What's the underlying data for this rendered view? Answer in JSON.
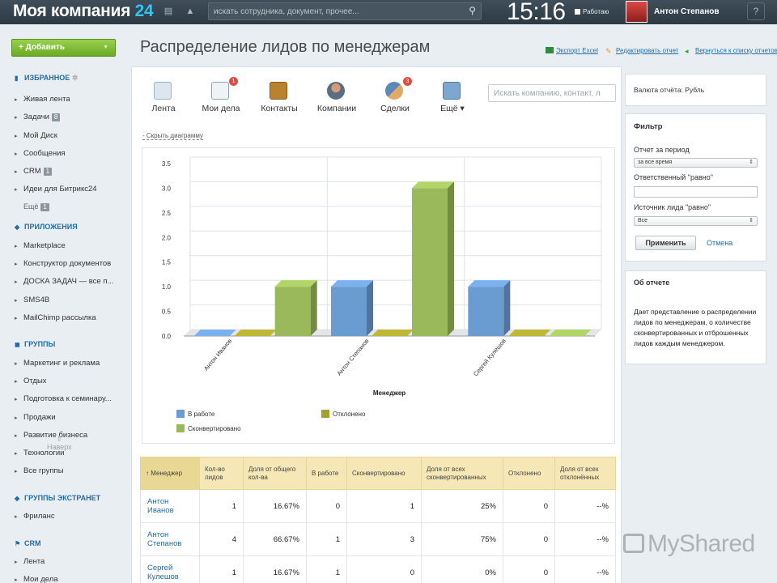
{
  "topbar": {
    "logo_main": "Моя компания",
    "logo_num": "24",
    "search_placeholder": "искать сотрудника, документ, прочее...",
    "clock": "15:16",
    "status": "Работаю",
    "user_name": "Антон Степанов",
    "help": "?"
  },
  "sidebar": {
    "add_label": "Добавить",
    "fav_header": "ИЗБРАННОЕ",
    "fav": [
      {
        "label": "Живая лента"
      },
      {
        "label": "Задачи",
        "count": "8"
      },
      {
        "label": "Мой Диск"
      },
      {
        "label": "Сообщения"
      },
      {
        "label": "CRM",
        "count": "1"
      },
      {
        "label": "Идеи для Битрикс24"
      }
    ],
    "fav_more": "Ещё",
    "fav_more_count": "1",
    "apps_header": "ПРИЛОЖЕНИЯ",
    "apps": [
      {
        "label": "Marketplace"
      },
      {
        "label": "Конструктор документов"
      },
      {
        "label": "ДОСКА ЗАДАЧ — все п..."
      },
      {
        "label": "SMS4B"
      },
      {
        "label": "MailChimp рассылка"
      }
    ],
    "groups_header": "ГРУППЫ",
    "groups": [
      {
        "label": "Маркетинг и реклама"
      },
      {
        "label": "Отдых"
      },
      {
        "label": "Подготовка к семинару..."
      },
      {
        "label": "Продажи"
      },
      {
        "label": "Развитие бизнеса"
      },
      {
        "label": "Технологии"
      },
      {
        "label": "Все группы"
      }
    ],
    "up_label": "Наверх",
    "extranet_header": "ГРУППЫ ЭКСТРАНЕТ",
    "extranet": [
      {
        "label": "Фриланс"
      }
    ],
    "crm_header": "CRM",
    "crm": [
      {
        "label": "Лента"
      },
      {
        "label": "Мои дела"
      }
    ]
  },
  "header": {
    "title": "Распределение лидов по менеджерам",
    "links": [
      "Экспорт Excel",
      "Редактировать отчет",
      "Вернуться к списку отчетов"
    ]
  },
  "nav": {
    "items": [
      {
        "label": "Лента"
      },
      {
        "label": "Мои дела",
        "badge": "1"
      },
      {
        "label": "Контакты"
      },
      {
        "label": "Компании"
      },
      {
        "label": "Сделки",
        "badge": "3"
      },
      {
        "label": "Ещё ▾"
      }
    ],
    "search_placeholder": "Искать компанию, контакт, л"
  },
  "hide_chart": "Скрыть диаграмму",
  "chart_data": {
    "type": "bar",
    "categories": [
      "Антон Иванов",
      "Антон Степанов",
      "Сергей Кулешов"
    ],
    "series": [
      {
        "name": "В работе",
        "values": [
          0,
          1,
          1
        ],
        "color": "#6a9bd1"
      },
      {
        "name": "Отклонено",
        "values": [
          0,
          0,
          0
        ],
        "color": "#a6a02e"
      },
      {
        "name": "Сконвертировано",
        "values": [
          1,
          3,
          0
        ],
        "color": "#9ab95a"
      }
    ],
    "xlabel": "Менеджер",
    "ylabel": "",
    "ylim": [
      0,
      3.5
    ],
    "yticks": [
      "0.0",
      "0.5",
      "1.0",
      "1.5",
      "2.0",
      "2.5",
      "3.0",
      "3.5"
    ],
    "grid": true,
    "legend_position": "bottom"
  },
  "table": {
    "headers": [
      "Менеджер",
      "Кол-во лидов",
      "Доля от общего кол-ва",
      "В работе",
      "Сконвертировано",
      "Доля от всех сконвертированных",
      "Отклонено",
      "Доля от всех отклонённых"
    ],
    "rows": [
      [
        "Антон Иванов",
        "1",
        "16.67%",
        "0",
        "1",
        "25%",
        "0",
        "--%"
      ],
      [
        "Антон Степанов",
        "4",
        "66.67%",
        "1",
        "3",
        "75%",
        "0",
        "--%"
      ],
      [
        "Сергей Кулешов",
        "1",
        "16.67%",
        "1",
        "0",
        "0%",
        "0",
        "--%"
      ]
    ]
  },
  "right": {
    "currency": "Валюта отчёта: Рубль",
    "filter_title": "Фильтр",
    "period_label": "Отчет за период",
    "period_value": "за все время",
    "responsible_label": "Ответственный \"равно\"",
    "source_label": "Источник лида \"равно\"",
    "source_value": "Все",
    "apply": "Применить",
    "cancel": "Отмена",
    "about_title": "Об отчете",
    "about_text": "Дает представление о распределении лидов по менеджерам, о количестве сконвертированных и отброшенных лидов каждым менеджером."
  },
  "watermark": "MyShared"
}
